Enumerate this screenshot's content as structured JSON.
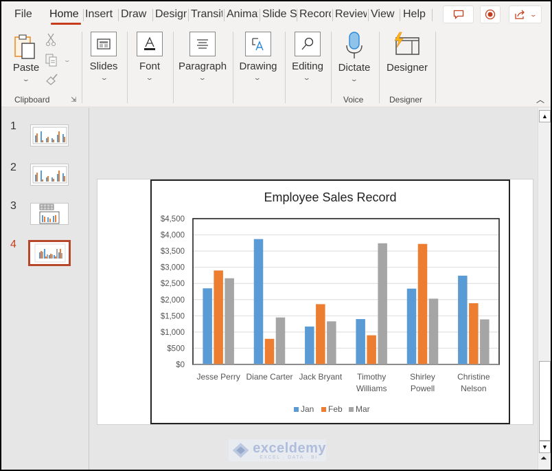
{
  "tabs": [
    {
      "label": "File",
      "active": false
    },
    {
      "label": "Home",
      "active": true
    },
    {
      "label": "Insert",
      "active": false
    },
    {
      "label": "Draw",
      "active": false
    },
    {
      "label": "Design",
      "active": false
    },
    {
      "label": "Transitions",
      "active": false
    },
    {
      "label": "Animations",
      "active": false
    },
    {
      "label": "Slide Show",
      "active": false
    },
    {
      "label": "Record",
      "active": false
    },
    {
      "label": "Review",
      "active": false
    },
    {
      "label": "View",
      "active": false
    },
    {
      "label": "Help",
      "active": false
    }
  ],
  "title_buttons": {
    "comments": "comment-icon",
    "record": "record-icon",
    "share": "share-icon"
  },
  "ribbon": {
    "clipboard": {
      "paste": "Paste",
      "group": "Clipboard"
    },
    "slides": "Slides",
    "font": "Font",
    "paragraph": "Paragraph",
    "drawing": "Drawing",
    "editing": "Editing",
    "dictate": "Dictate",
    "voice_group": "Voice",
    "designer": "Designer",
    "designer_group": "Designer"
  },
  "slides": [
    {
      "number": "1",
      "active": false
    },
    {
      "number": "2",
      "active": false
    },
    {
      "number": "3",
      "active": false
    },
    {
      "number": "4",
      "active": true
    }
  ],
  "watermark": {
    "brand": "exceldemy",
    "tagline": "EXCEL · DATA · BI"
  },
  "colors": {
    "accent": "#c43e1c",
    "jan": "#5b9bd5",
    "feb": "#ed7d31",
    "mar": "#a5a5a5"
  },
  "chart_data": {
    "type": "bar",
    "title": "Employee Sales Record",
    "xlabel": "",
    "ylabel": "",
    "categories": [
      "Jesse Perry",
      "Diane Carter",
      "Jack Bryant",
      "Timothy Williams",
      "Shirley Powell",
      "Christine Nelson"
    ],
    "category_lines": [
      [
        "Jesse Perry"
      ],
      [
        "Diane Carter"
      ],
      [
        "Jack Bryant"
      ],
      [
        "Timothy",
        "Williams"
      ],
      [
        "Shirley",
        "Powell"
      ],
      [
        "Christine",
        "Nelson"
      ]
    ],
    "series": [
      {
        "name": "Jan",
        "color": "#5b9bd5",
        "values": [
          2350,
          3870,
          1170,
          1400,
          2340,
          2740
        ]
      },
      {
        "name": "Feb",
        "color": "#ed7d31",
        "values": [
          2900,
          790,
          1860,
          900,
          3720,
          1890
        ]
      },
      {
        "name": "Mar",
        "color": "#a5a5a5",
        "values": [
          2660,
          1450,
          1330,
          3740,
          2030,
          1390
        ]
      }
    ],
    "yticks": [
      "$0",
      "$500",
      "$1,000",
      "$1,500",
      "$2,000",
      "$2,500",
      "$3,000",
      "$3,500",
      "$4,000",
      "$4,500"
    ],
    "ylim": [
      0,
      4500
    ],
    "ystep": 500,
    "grid": true,
    "legend": "bottom"
  }
}
